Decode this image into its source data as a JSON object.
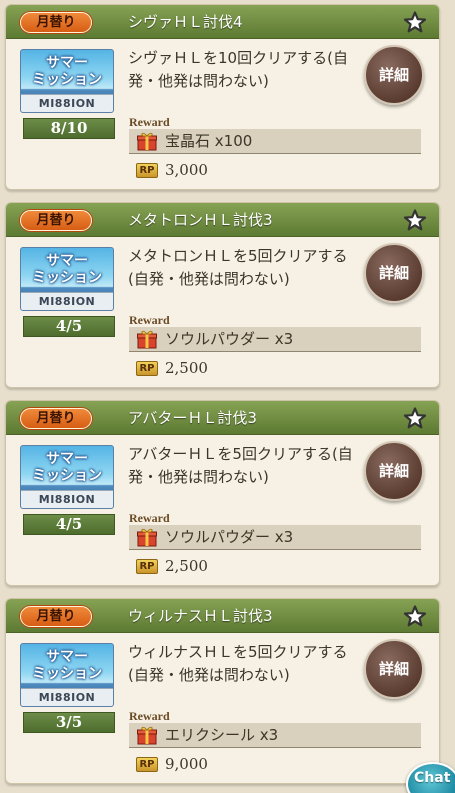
{
  "missions": [
    {
      "badge": "月替り",
      "title": "シヴァＨＬ討伐4",
      "thumb_line1": "サマー",
      "thumb_line2": "ミッション",
      "thumb_mission": "MI88ION",
      "progress": "8/10",
      "desc": "シヴァＨＬを10回クリアする(自発・他発は問わない)",
      "detail_label": "詳細",
      "reward_label": "Reward",
      "reward_item": "宝晶石 x100",
      "rp_icon": "RP",
      "rp_value": "3,000"
    },
    {
      "badge": "月替り",
      "title": "メタトロンＨＬ討伐3",
      "thumb_line1": "サマー",
      "thumb_line2": "ミッション",
      "thumb_mission": "MI88ION",
      "progress": "4/5",
      "desc": "メタトロンＨＬを5回クリアする(自発・他発は問わない)",
      "detail_label": "詳細",
      "reward_label": "Reward",
      "reward_item": "ソウルパウダー x3",
      "rp_icon": "RP",
      "rp_value": "2,500"
    },
    {
      "badge": "月替り",
      "title": "アバターＨＬ討伐3",
      "thumb_line1": "サマー",
      "thumb_line2": "ミッション",
      "thumb_mission": "MI88ION",
      "progress": "4/5",
      "desc": "アバターＨＬを5回クリアする(自発・他発は問わない)",
      "detail_label": "詳細",
      "reward_label": "Reward",
      "reward_item": "ソウルパウダー x3",
      "rp_icon": "RP",
      "rp_value": "2,500"
    },
    {
      "badge": "月替り",
      "title": "ウィルナスＨＬ討伐3",
      "thumb_line1": "サマー",
      "thumb_line2": "ミッション",
      "thumb_mission": "MI88ION",
      "progress": "3/5",
      "desc": "ウィルナスＨＬを5回クリアする(自発・他発は問わない)",
      "detail_label": "詳細",
      "reward_label": "Reward",
      "reward_item": "エリクシール x3",
      "rp_icon": "RP",
      "rp_value": "9,000"
    }
  ],
  "chat_label": "Chat",
  "colors": {
    "header_green": "#5d7a33",
    "badge_orange": "#d65d14",
    "detail_brown": "#5a3c31",
    "progress_green": "#4e6d2e",
    "background": "#e7dfcc"
  },
  "icons": [
    "star-icon",
    "gift-icon",
    "rp-icon"
  ]
}
